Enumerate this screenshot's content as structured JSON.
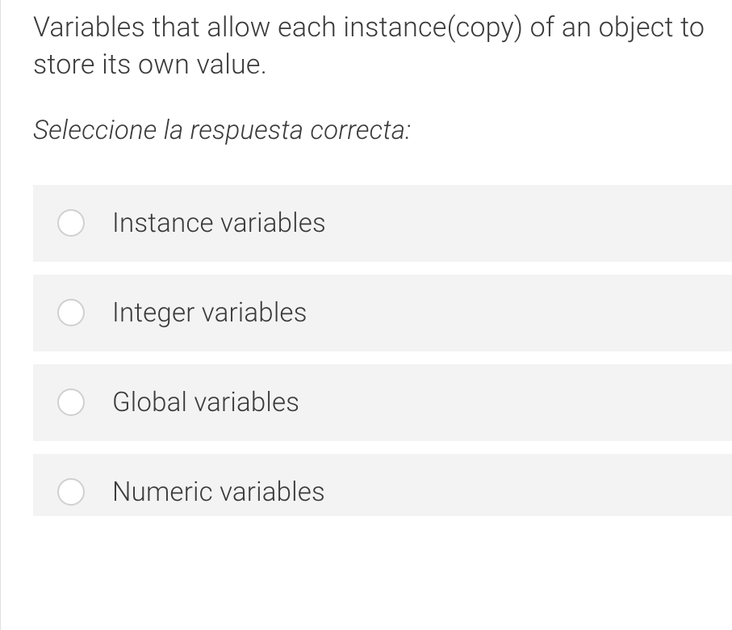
{
  "question": {
    "text": "Variables that allow each instance(copy) of an object to store its own value.",
    "instruction": "Seleccione la respuesta correcta:",
    "options": [
      {
        "label": "Instance variables"
      },
      {
        "label": "Integer variables"
      },
      {
        "label": "Global variables"
      },
      {
        "label": "Numeric variables"
      }
    ]
  }
}
